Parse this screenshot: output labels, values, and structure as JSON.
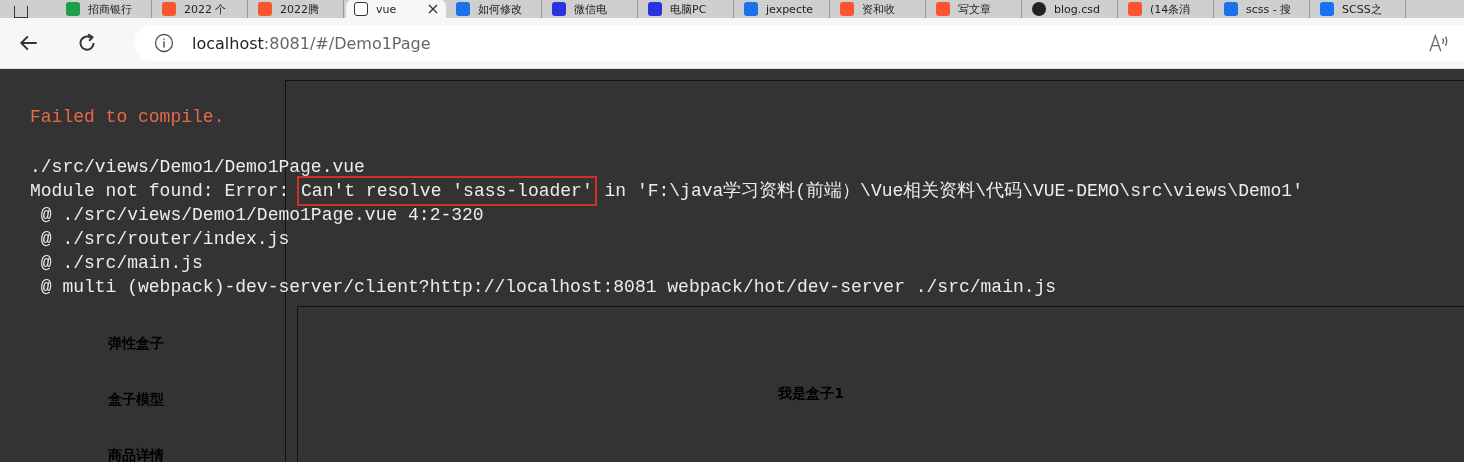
{
  "tabs": [
    {
      "label": "招商银行",
      "kind": "sheet",
      "selected": false
    },
    {
      "label": "2022 个",
      "kind": "csdn",
      "selected": false
    },
    {
      "label": "2022腾",
      "kind": "csdn",
      "selected": false
    },
    {
      "label": "vue",
      "kind": "page",
      "selected": true
    },
    {
      "label": "如何修改",
      "kind": "search",
      "selected": false
    },
    {
      "label": "微信电",
      "kind": "baidu",
      "selected": false
    },
    {
      "label": "电脑PC",
      "kind": "baidu",
      "selected": false
    },
    {
      "label": "jexpecte",
      "kind": "search",
      "selected": false
    },
    {
      "label": "资和收",
      "kind": "csdn",
      "selected": false
    },
    {
      "label": "写文章",
      "kind": "csdn",
      "selected": false
    },
    {
      "label": "blog.csd",
      "kind": "blocked",
      "selected": false
    },
    {
      "label": "(14条消",
      "kind": "csdn",
      "selected": false
    },
    {
      "label": "scss - 搜",
      "kind": "search",
      "selected": false
    },
    {
      "label": "SCSS之",
      "kind": "zhihu",
      "selected": false
    }
  ],
  "address_bar": {
    "host": "localhost",
    "path": ":8081/#/Demo1Page"
  },
  "page": {
    "sidebar": {
      "items": [
        "弹性盒子",
        "盒子模型",
        "商品详情"
      ]
    },
    "box": {
      "label": "我是盒子1"
    }
  },
  "error_overlay": {
    "title": "Failed to compile.",
    "file": "./src/views/Demo1/Demo1Page.vue",
    "error": {
      "prefix": "Module not found: Error:",
      "highlight": "Can't resolve 'sass-loader'",
      "suffix": "in 'F:\\java学习资料(前端）\\Vue相关资料\\代码\\VUE-DEMO\\src\\views\\Demo1'"
    },
    "trace": [
      " @ ./src/views/Demo1/Demo1Page.vue 4:2-320",
      " @ ./src/router/index.js",
      " @ ./src/main.js",
      " @ multi (webpack)-dev-server/client?http://localhost:8081 webpack/hot/dev-server ./src/main.js"
    ]
  }
}
